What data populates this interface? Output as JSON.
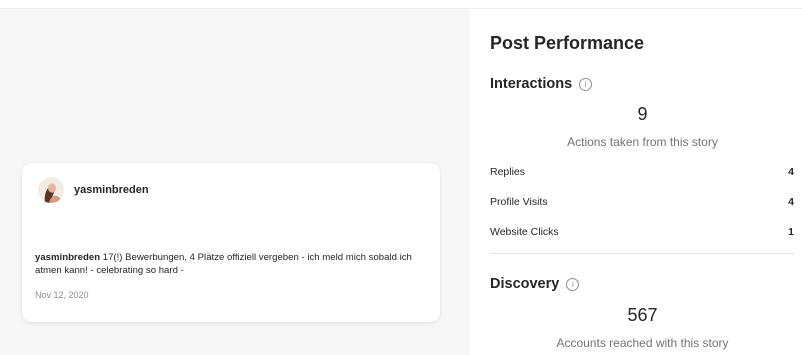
{
  "post": {
    "username": "yasminbreden",
    "caption_user": "yasminbreden",
    "caption_text": " 17(!) Bewerbungen, 4 Plätze offiziell vergeben - ich meld mich sobald ich atmen kann! - celebrating so hard -",
    "date": "Nov 12, 2020"
  },
  "performance": {
    "title": "Post Performance",
    "interactions": {
      "title": "Interactions",
      "count": "9",
      "subtitle": "Actions taken from this story",
      "metrics": [
        {
          "label": "Replies",
          "value": "4"
        },
        {
          "label": "Profile Visits",
          "value": "4"
        },
        {
          "label": "Website Clicks",
          "value": "1"
        }
      ]
    },
    "discovery": {
      "title": "Discovery",
      "count": "567",
      "subtitle": "Accounts reached with this story"
    },
    "info_icon": "info-icon"
  }
}
